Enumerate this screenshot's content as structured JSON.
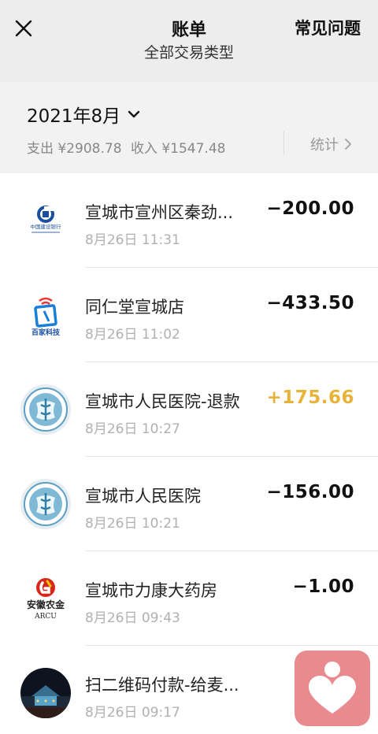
{
  "header": {
    "title": "账单",
    "faq_label": "常见问题",
    "filter_label": "全部交易类型"
  },
  "month_bar": {
    "month": "2021年8月",
    "expense": "支出 ¥2908.78",
    "income": "收入 ¥1547.48",
    "stats_label": "统计"
  },
  "transactions": [
    {
      "name": "宣城市宣州区秦劲...",
      "time": "8月26日 11:31",
      "amount": "−200.00",
      "icon": "ccb-bank-logo"
    },
    {
      "name": "同仁堂宣城店",
      "time": "8月26日 11:02",
      "amount": "−433.50",
      "icon": "baijia-tech-logo"
    },
    {
      "name": "宣城市人民医院-退款",
      "time": "8月26日 10:27",
      "amount": "+175.66",
      "icon": "hospital-logo"
    },
    {
      "name": "宣城市人民医院",
      "time": "8月26日 10:21",
      "amount": "−156.00",
      "icon": "hospital-logo"
    },
    {
      "name": "宣城市力康大药房",
      "time": "8月26日 09:43",
      "amount": "−1.00",
      "icon": "arcu-bank-logo"
    },
    {
      "name": "扫二维码付款-给麦...",
      "time": "8月26日 09:17",
      "amount": "",
      "icon": "night-scene-photo"
    }
  ],
  "logo_text": {
    "ccb": "中国建设银行",
    "baijia": "百家科技",
    "arcu_cn": "安徽农金",
    "arcu_en": "ARCU"
  },
  "colors": {
    "refund": "#e8b339",
    "header_bg": "#ededed",
    "month_bg": "#f2f2f2",
    "float_btn": "#e98b8e"
  }
}
